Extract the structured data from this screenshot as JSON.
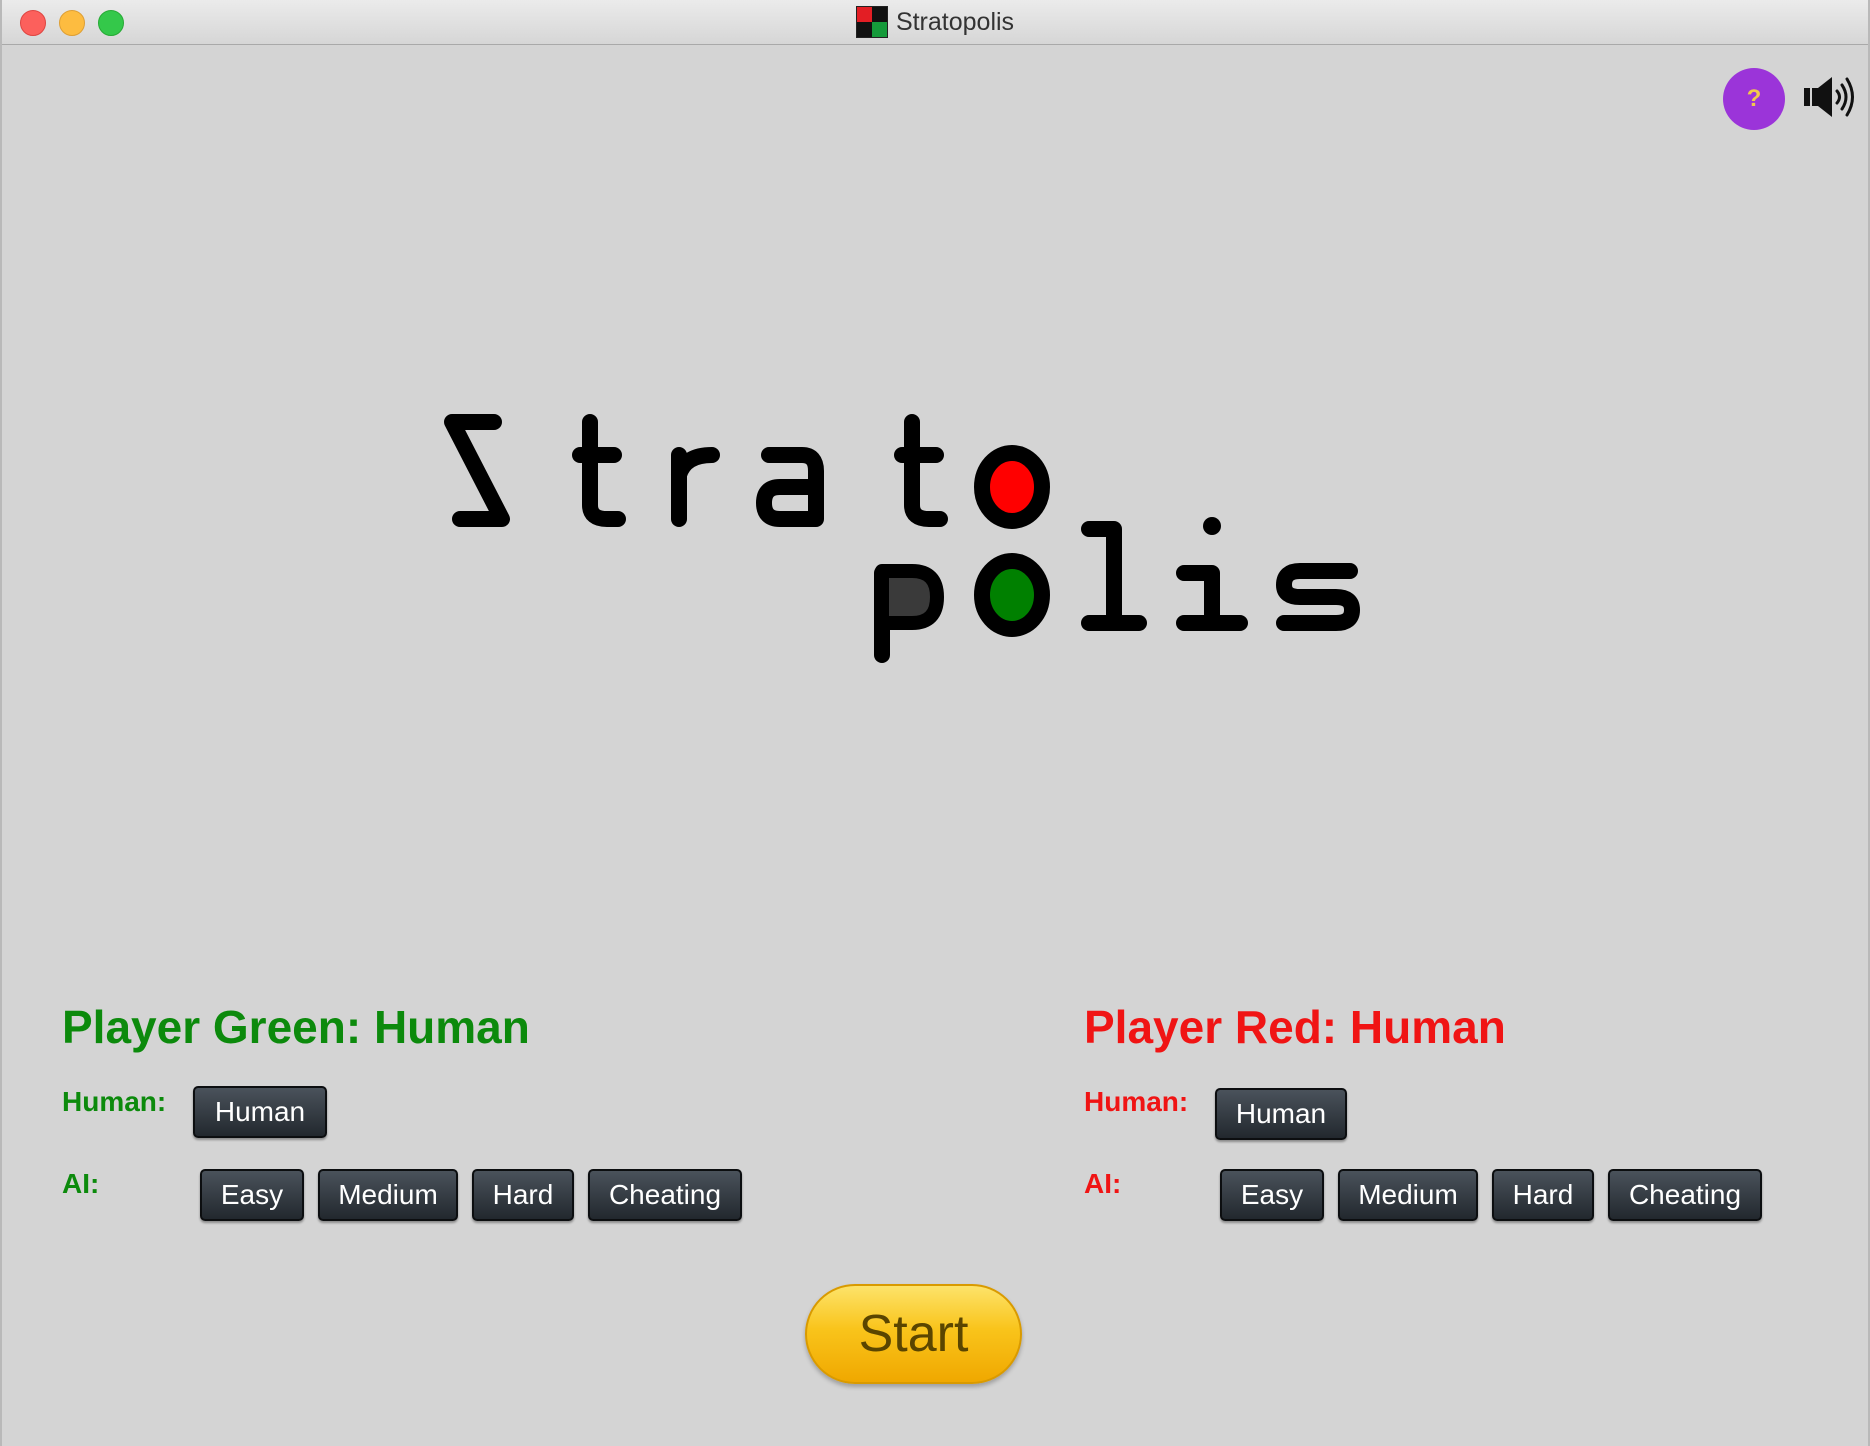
{
  "window": {
    "title": "Stratopolis",
    "controls": [
      "close",
      "minimize",
      "zoom"
    ]
  },
  "toolbar": {
    "help_label": "?",
    "help_color": "#9b34d9",
    "sound_icon": "speaker-volume-icon"
  },
  "logo": {
    "line1": "Strato",
    "line2": "polis",
    "colors": {
      "red": "#ff0000",
      "green": "#008000",
      "dark": "#3a3a3a"
    }
  },
  "players": {
    "green": {
      "heading": "Player Green: Human",
      "color": "#0c8a0c",
      "human_label": "Human:",
      "human_button": "Human",
      "ai_label": "AI:",
      "ai_buttons": [
        "Easy",
        "Medium",
        "Hard",
        "Cheating"
      ]
    },
    "red": {
      "heading": "Player Red: Human",
      "color": "#f01414",
      "human_label": "Human:",
      "human_button": "Human",
      "ai_label": "AI:",
      "ai_buttons": [
        "Easy",
        "Medium",
        "Hard",
        "Cheating"
      ]
    }
  },
  "start": {
    "label": "Start",
    "color": "#f9c41b"
  }
}
